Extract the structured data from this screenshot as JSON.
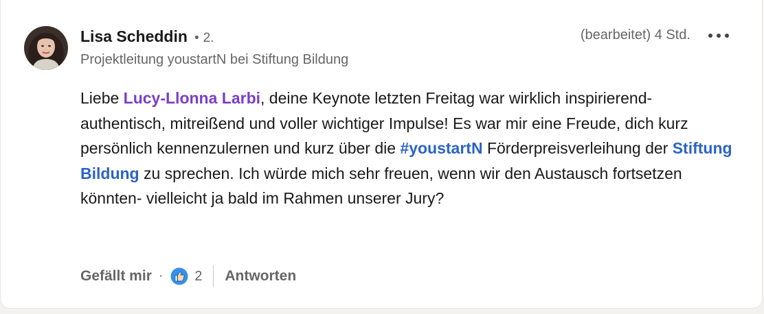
{
  "comment": {
    "author": {
      "name": "Lisa Scheddin",
      "separator": "•",
      "connection_degree": "2.",
      "headline": "Projektleitung youstartN bei Stiftung Bildung"
    },
    "edited_label": "(bearbeitet)",
    "timestamp": "4 Std.",
    "more_options_icon": "ellipsis-icon",
    "body": {
      "prefix": "Liebe ",
      "mention": "Lucy-Llonna Larbi",
      "part1": ", deine Keynote letzten Freitag war wirklich inspirierend- authentisch, mitreißend und voller wichtiger Impulse! Es war mir eine Freude, dich kurz persönlich kennenzulernen und kurz über die ",
      "hashtag": "#youstartN",
      "part2": " Förderpreisverleihung der ",
      "company_mention": "Stiftung Bildung",
      "part3": " zu sprechen. Ich würde mich sehr freuen, wenn wir den Austausch fortsetzen könnten- vielleicht ja bald im Rahmen unserer Jury?"
    },
    "actions": {
      "like_label": "Gefällt mir",
      "dot": "·",
      "reaction_icon": "thumbs-up-icon",
      "reaction_count": "2",
      "reply_label": "Antworten"
    }
  },
  "colors": {
    "mention": "#7a3fc8",
    "link": "#2b63c5",
    "reaction_blue": "#378fe9"
  }
}
